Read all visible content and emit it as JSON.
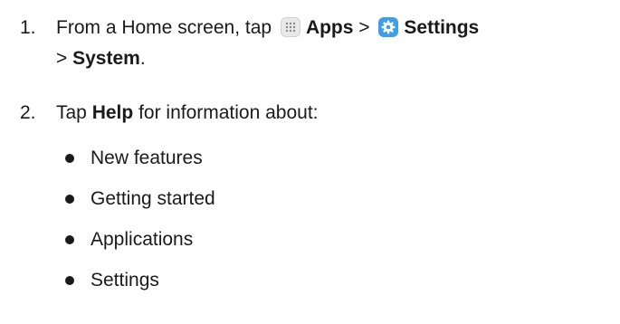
{
  "steps": [
    {
      "number": "1.",
      "text_before_apps": "From a Home screen, tap",
      "apps_label": "Apps",
      "separator_1": ">",
      "settings_label": "Settings",
      "separator_2": ">",
      "system_label": "System",
      "end_punct": ".",
      "icons": [
        "apps-icon",
        "settings-gear-icon"
      ]
    },
    {
      "number": "2.",
      "text_before": "Tap",
      "help_label": "Help",
      "text_after": "for information about:"
    }
  ],
  "help_topics": [
    "New features",
    "Getting started",
    "Applications",
    "Settings"
  ],
  "colors": {
    "settings_icon_bg": "#3f9ee8",
    "apps_icon_bg": "#e9e9e9",
    "text": "#1a1a1a"
  }
}
